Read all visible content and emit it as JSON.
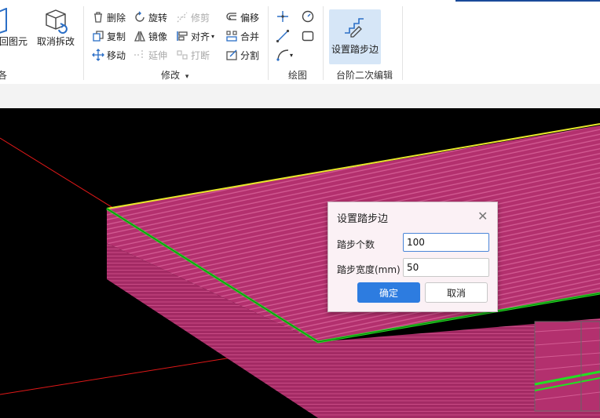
{
  "ribbon": {
    "left_buttons": [
      {
        "label": "回图元",
        "icon": "box-return-icon"
      },
      {
        "label": "取消拆改",
        "icon": "box-undo-icon"
      }
    ],
    "left_group_label": "各",
    "modify": {
      "items": [
        {
          "label": "删除",
          "icon": "trash-icon",
          "enabled": true
        },
        {
          "label": "旋转",
          "icon": "rotate-icon",
          "enabled": true
        },
        {
          "label": "修剪",
          "icon": "trim-icon",
          "enabled": false
        },
        {
          "label": "偏移",
          "icon": "offset-icon",
          "enabled": true
        },
        {
          "label": "复制",
          "icon": "copy-icon",
          "enabled": true
        },
        {
          "label": "镜像",
          "icon": "mirror-icon",
          "enabled": true
        },
        {
          "label": "对齐",
          "icon": "align-icon",
          "enabled": true
        },
        {
          "label": "合并",
          "icon": "merge-icon",
          "enabled": true
        },
        {
          "label": "移动",
          "icon": "move-icon",
          "enabled": true
        },
        {
          "label": "延伸",
          "icon": "extend-icon",
          "enabled": false
        },
        {
          "label": "打断",
          "icon": "break-icon",
          "enabled": false
        },
        {
          "label": "分割",
          "icon": "split-icon",
          "enabled": true
        }
      ],
      "group_label": "修改"
    },
    "draw": {
      "tools": [
        "point-icon",
        "circle-icon",
        "line-icon",
        "rectangle-icon",
        "arc-icon"
      ],
      "group_label": "绘图"
    },
    "step": {
      "button_label": "设置踏步边",
      "icon": "stairs-pencil-icon",
      "group_label": "台阶二次编辑"
    }
  },
  "dialog": {
    "title": "设置踏步边",
    "fields": [
      {
        "label": "踏步个数",
        "value": "100"
      },
      {
        "label": "踏步宽度(mm)",
        "value": "50"
      }
    ],
    "ok_label": "确定",
    "cancel_label": "取消"
  },
  "colors": {
    "slab": "#b3306e",
    "slab_side": "#a32a64",
    "edge_green": "#22e022",
    "edge_yellow": "#e8e82a",
    "axis_red": "#e01818",
    "primary": "#2d7ce0"
  }
}
